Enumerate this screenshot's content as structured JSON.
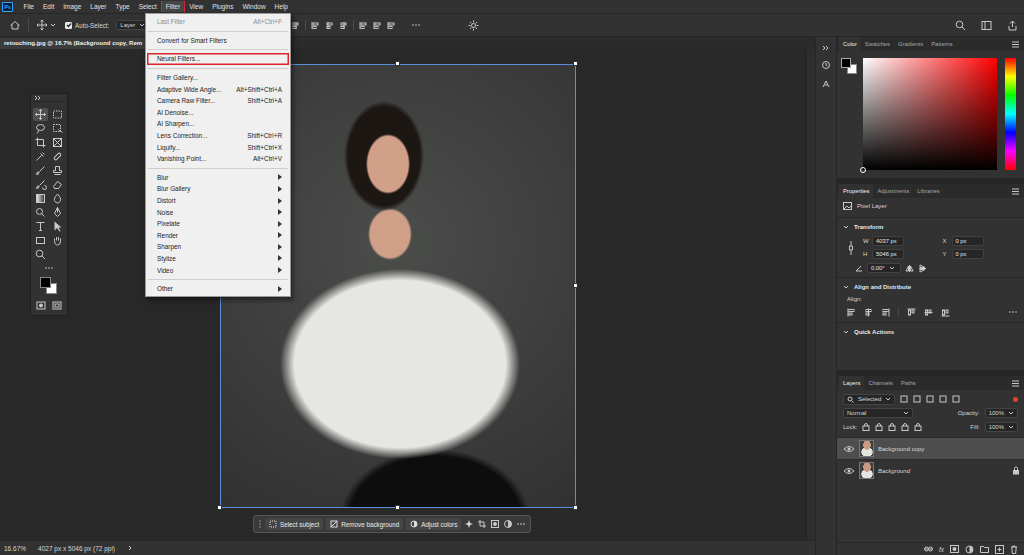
{
  "menubar": {
    "logo": "Ps",
    "items": [
      {
        "label": "File",
        "selected": false,
        "highlighted": false
      },
      {
        "label": "Edit",
        "selected": false,
        "highlighted": false
      },
      {
        "label": "Image",
        "selected": false,
        "highlighted": false
      },
      {
        "label": "Layer",
        "selected": false,
        "highlighted": false
      },
      {
        "label": "Type",
        "selected": false,
        "highlighted": false
      },
      {
        "label": "Select",
        "selected": false,
        "highlighted": false
      },
      {
        "label": "Filter",
        "selected": true,
        "highlighted": true
      },
      {
        "label": "View",
        "selected": false,
        "highlighted": false
      },
      {
        "label": "Plugins",
        "selected": false,
        "highlighted": false
      },
      {
        "label": "Window",
        "selected": false,
        "highlighted": false
      },
      {
        "label": "Help",
        "selected": false,
        "highlighted": false
      }
    ]
  },
  "options_bar": {
    "auto_select": {
      "label": "Auto-Select:",
      "checked": true
    },
    "target": "Layer"
  },
  "document": {
    "tab_title": "retouching.jpg @ 16.7% (Background copy, Rem"
  },
  "filter_menu": {
    "items": [
      {
        "kind": "item",
        "label": "Last Filter",
        "shortcut": "Alt+Ctrl+F",
        "disabled": true,
        "highlighted": false,
        "submenu": false
      },
      {
        "kind": "separator"
      },
      {
        "kind": "item",
        "label": "Convert for Smart Filters",
        "disabled": false,
        "highlighted": false,
        "submenu": false
      },
      {
        "kind": "separator"
      },
      {
        "kind": "item",
        "label": "Neural Filters...",
        "disabled": false,
        "highlighted": true,
        "submenu": false
      },
      {
        "kind": "separator"
      },
      {
        "kind": "item",
        "label": "Filter Gallery...",
        "disabled": false,
        "highlighted": false,
        "submenu": false
      },
      {
        "kind": "item",
        "label": "Adaptive Wide Angle...",
        "shortcut": "Alt+Shift+Ctrl+A",
        "disabled": false,
        "highlighted": false,
        "submenu": false
      },
      {
        "kind": "item",
        "label": "Camera Raw Filter...",
        "shortcut": "Shift+Ctrl+A",
        "disabled": false,
        "highlighted": false,
        "submenu": false
      },
      {
        "kind": "item",
        "label": "AI Denoise...",
        "disabled": false,
        "highlighted": false,
        "submenu": false
      },
      {
        "kind": "item",
        "label": "AI Sharpen...",
        "disabled": false,
        "highlighted": false,
        "submenu": false
      },
      {
        "kind": "item",
        "label": "Lens Correction...",
        "shortcut": "Shift+Ctrl+R",
        "disabled": false,
        "highlighted": false,
        "submenu": false
      },
      {
        "kind": "item",
        "label": "Liquify...",
        "shortcut": "Shift+Ctrl+X",
        "disabled": false,
        "highlighted": false,
        "submenu": false
      },
      {
        "kind": "item",
        "label": "Vanishing Point...",
        "shortcut": "Alt+Ctrl+V",
        "disabled": false,
        "highlighted": false,
        "submenu": false
      },
      {
        "kind": "separator"
      },
      {
        "kind": "item",
        "label": "Blur",
        "disabled": false,
        "highlighted": false,
        "submenu": true
      },
      {
        "kind": "item",
        "label": "Blur Gallery",
        "disabled": false,
        "highlighted": false,
        "submenu": true
      },
      {
        "kind": "item",
        "label": "Distort",
        "disabled": false,
        "highlighted": false,
        "submenu": true
      },
      {
        "kind": "item",
        "label": "Noise",
        "disabled": false,
        "highlighted": false,
        "submenu": true
      },
      {
        "kind": "item",
        "label": "Pixelate",
        "disabled": false,
        "highlighted": false,
        "submenu": true
      },
      {
        "kind": "item",
        "label": "Render",
        "disabled": false,
        "highlighted": false,
        "submenu": true
      },
      {
        "kind": "item",
        "label": "Sharpen",
        "disabled": false,
        "highlighted": false,
        "submenu": true
      },
      {
        "kind": "item",
        "label": "Stylize",
        "disabled": false,
        "highlighted": false,
        "submenu": true
      },
      {
        "kind": "item",
        "label": "Video",
        "disabled": false,
        "highlighted": false,
        "submenu": true
      },
      {
        "kind": "separator"
      },
      {
        "kind": "item",
        "label": "Other",
        "disabled": false,
        "highlighted": false,
        "submenu": true
      }
    ]
  },
  "task_bar": {
    "buttons": [
      "Select subject",
      "Remove background",
      "Adjust colors"
    ]
  },
  "status_bar": {
    "zoom": "16.67%",
    "info": "4027 px x 5046 px (72 ppi)"
  },
  "color_panel": {
    "tabs": [
      {
        "label": "Color",
        "selected": true
      },
      {
        "label": "Swatches",
        "selected": false
      },
      {
        "label": "Gradients",
        "selected": false
      },
      {
        "label": "Patterns",
        "selected": false
      }
    ]
  },
  "properties": {
    "tabs": [
      {
        "label": "Properties",
        "selected": true
      },
      {
        "label": "Adjustments",
        "selected": false
      },
      {
        "label": "Libraries",
        "selected": false
      }
    ],
    "layer_kind": "Pixel Layer",
    "transform": {
      "title": "Transform",
      "expanded": true,
      "fields": [
        {
          "label": "W",
          "value": "4037 px"
        },
        {
          "label": "X",
          "value": "0 px"
        },
        {
          "label": "H",
          "value": "5046 px"
        },
        {
          "label": "Y",
          "value": "0 px"
        }
      ],
      "angle": "0.00°"
    },
    "align": {
      "title": "Align and Distribute",
      "expanded": true,
      "label": "Align:"
    },
    "quick_actions": {
      "title": "Quick Actions",
      "expanded": true
    }
  },
  "layers": {
    "tabs": [
      {
        "label": "Layers",
        "selected": true
      },
      {
        "label": "Channels",
        "selected": false
      },
      {
        "label": "Paths",
        "selected": false
      }
    ],
    "filter": "Selected",
    "blend_mode": "Normal",
    "opacity": {
      "label": "Opacity:",
      "value": "100%"
    },
    "lock_label": "Lock:",
    "fill": {
      "label": "Fill:",
      "value": "100%"
    },
    "items": [
      {
        "name": "Background copy",
        "selected": true,
        "visible": true,
        "locked": false
      },
      {
        "name": "Background",
        "selected": false,
        "visible": true,
        "locked": true
      }
    ],
    "fx": "fx"
  }
}
